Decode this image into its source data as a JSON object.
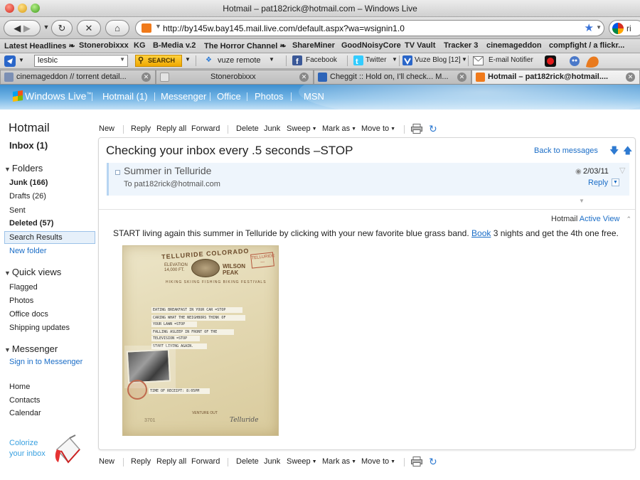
{
  "window": {
    "title": "Hotmail – pat182rick@hotmail.com – Windows Live"
  },
  "navbar": {
    "url": "http://by145w.bay145.mail.live.com/default.aspx?wa=wsignin1.0",
    "search_engine_partial": "ri"
  },
  "bookmarks": [
    "Latest Headlines ❧",
    "Stonerobixxx",
    "KG",
    "B-Media v.2",
    "The Horror Channel ❧",
    "ShareMiner",
    "GoodNoisyCore",
    "TV Vault",
    "Tracker 3",
    "cinemageddon",
    "compfight / a flickr..."
  ],
  "toolbar2": {
    "search_value": "lesbic",
    "search_button": "SEARCH",
    "vuze_remote": "vuze remote",
    "facebook": "Facebook",
    "twitter": "Twitter",
    "vuze_blog": "Vuze Blog [12]",
    "email_notifier": "E-mail Notifier"
  },
  "tabs": [
    {
      "label": "cinemageddon // torrent detail...",
      "active": false
    },
    {
      "label": "Stonerobixxx",
      "active": false
    },
    {
      "label": "Cheggit :: Hold on, I'll check... M...",
      "active": false
    },
    {
      "label": "Hotmail – pat182rick@hotmail....",
      "active": true
    }
  ],
  "wl_header": {
    "logo": "Windows Live",
    "logo_tm": "™",
    "nav": [
      "Hotmail (1)",
      "Messenger",
      "Office",
      "Photos",
      "MSN"
    ]
  },
  "sidebar": {
    "title": "Hotmail",
    "inbox": "Inbox (1)",
    "folders_heading": "Folders",
    "folders": [
      {
        "label": "Junk (166)",
        "bold": true
      },
      {
        "label": "Drafts (26)",
        "bold": false
      },
      {
        "label": "Sent",
        "bold": false
      },
      {
        "label": "Deleted (57)",
        "bold": true
      },
      {
        "label": "Search Results",
        "bold": false
      },
      {
        "label": "New folder",
        "link": true
      }
    ],
    "quick_views_heading": "Quick views",
    "quick_views": [
      "Flagged",
      "Photos",
      "Office docs",
      "Shipping updates"
    ],
    "messenger_heading": "Messenger",
    "messenger_signin": "Sign in to Messenger",
    "bottom_links": [
      "Home",
      "Contacts",
      "Calendar"
    ],
    "colorize_line1": "Colorize",
    "colorize_line2": "your inbox"
  },
  "actions": {
    "new": "New",
    "reply": "Reply",
    "reply_all": "Reply all",
    "forward": "Forward",
    "delete": "Delete",
    "junk": "Junk",
    "sweep": "Sweep",
    "mark_as": "Mark as",
    "move_to": "Move to"
  },
  "message": {
    "subject": "Checking your inbox every .5 seconds –STOP",
    "back_to_messages": "Back to messages",
    "from": "Summer in Telluride",
    "to": "To pat182rick@hotmail.com",
    "date": "2/03/11",
    "reply": "Reply",
    "active_view_prefix": "Hotmail",
    "active_view_link": "Active View",
    "body_before_link": "START living again this summer in Telluride by clicking with your new favorite blue grass band. ",
    "body_link": "Book",
    "body_after_link": " 3 nights and get the 4th one free."
  },
  "telegram": {
    "arch": "TELLURIDE COLORADO",
    "elevation": "ELEVATION\n14,000 FT.",
    "wilson": "WILSON\nPEAK",
    "stamp": "TELLURIDE\n---",
    "subline": "HIKING  SKIING  FISHING  BIKING  FESTIVALS",
    "lines": [
      "EATING BREAKFAST IN YOUR CAR =STOP",
      "CARING WHAT THE NEIGHBORS THINK OF",
      "YOUR LAWN =STOP",
      "FALLING ASLEEP IN FRONT OF THE",
      "TELEVISION =STOP",
      "START LIVING AGAIN."
    ],
    "receipt": "TIME OF RECEIPT: 8:05PM",
    "footer": "VENTURE OUT",
    "number": "3701",
    "signature": "Telluride"
  }
}
